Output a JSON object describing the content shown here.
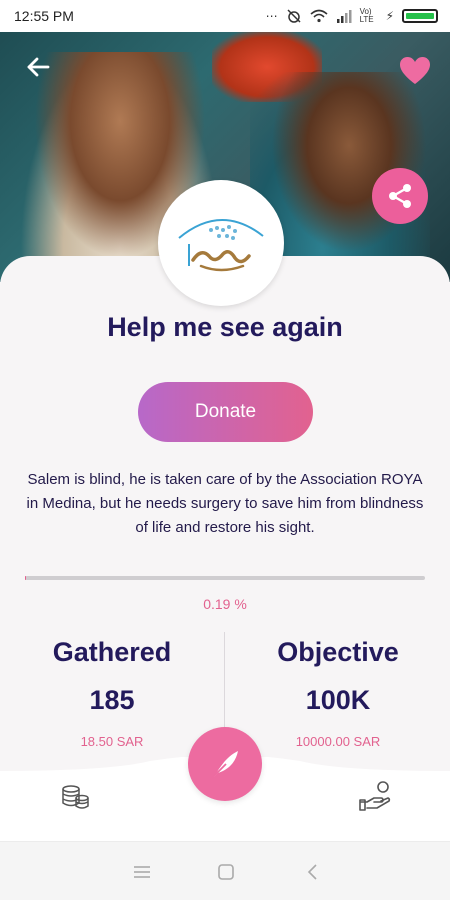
{
  "status_bar": {
    "time": "12:55 PM",
    "network_label": "Vo) LTE"
  },
  "hero": {
    "image_subject": "two men drinking"
  },
  "campaign": {
    "title": "Help me see again",
    "donate_label": "Donate",
    "description": "Salem is blind, he is taken care of by the Association ROYA  in Medina, but he needs surgery to save him from blindness of life and restore his sight.",
    "progress_percent_text": "0.19 %",
    "progress_fraction": 0.0019
  },
  "stats": {
    "gathered_label": "Gathered",
    "gathered_value": "185",
    "gathered_sar": "18.50 SAR",
    "objective_label": "Objective",
    "objective_value": "100K",
    "objective_sar": "10000.00 SAR"
  },
  "colors": {
    "accent_pink": "#e2628f",
    "title_navy": "#231a5c",
    "donate_gradient_start": "#b768c9",
    "donate_gradient_end": "#e2628f"
  },
  "icons": {
    "back": "back-arrow-icon",
    "favorite": "heart-icon",
    "share": "share-icon",
    "logo": "roya-logo",
    "center": "feather-icon",
    "coins": "coins-icon",
    "donate_hand": "hand-coin-icon"
  }
}
